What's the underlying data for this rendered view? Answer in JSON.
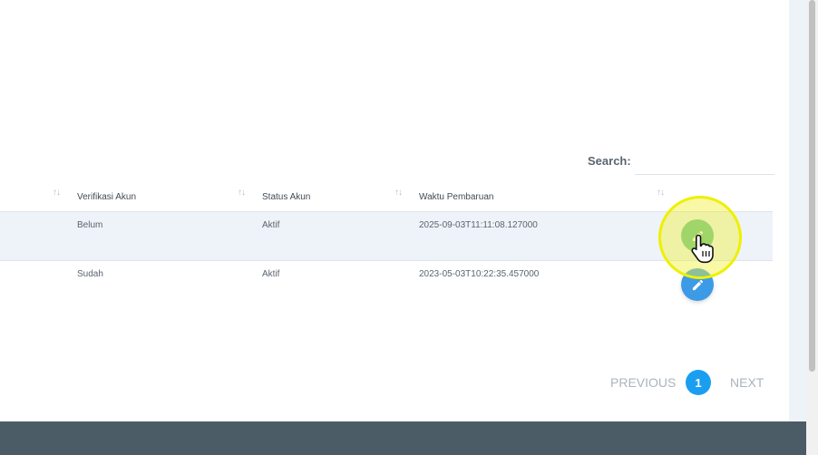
{
  "search": {
    "label": "Search:",
    "value": "",
    "placeholder": ""
  },
  "table": {
    "sort_icon": "↑↓",
    "columns": [
      "Verifikasi Akun",
      "Status Akun",
      "Waktu Pembaruan",
      ""
    ],
    "rows": [
      {
        "verifikasi": "Belum",
        "status": "Aktif",
        "waktu": "2025-09-03T11:11:08.127000",
        "action_icon": "pencil-icon"
      },
      {
        "verifikasi": "Sudah",
        "status": "Aktif",
        "waktu": "2023-05-03T10:22:35.457000",
        "action_icon": "pencil-icon"
      }
    ]
  },
  "pagination": {
    "previous": "PREVIOUS",
    "current_page": "1",
    "next": "NEXT"
  },
  "colors": {
    "accent": "#1a9ff0",
    "edit_button_hover": "#5fbf8f",
    "edit_button": "#3d9ae6",
    "row_highlight": "#eef3f9",
    "footer": "#4c5c66"
  }
}
